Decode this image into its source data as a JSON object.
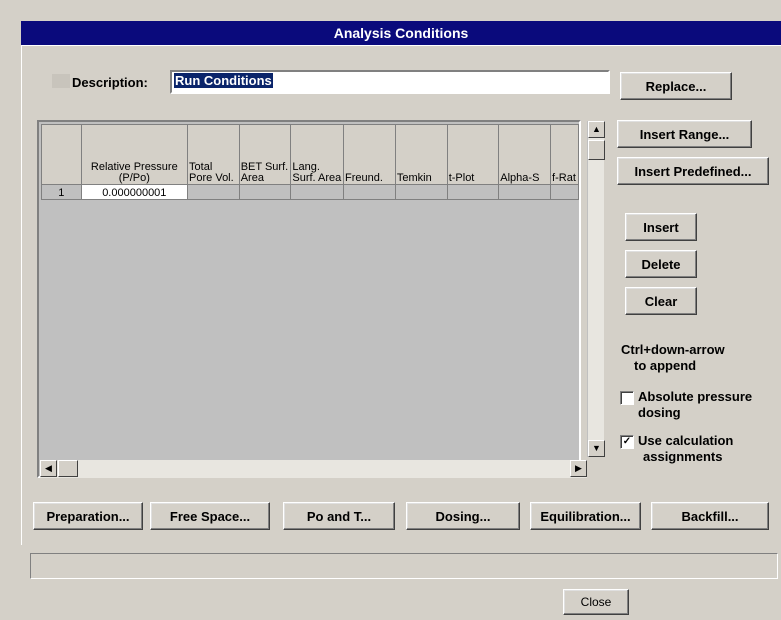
{
  "window": {
    "title": "Analysis Conditions"
  },
  "description": {
    "label": "Description:",
    "value": "Run Conditions"
  },
  "buttons": {
    "replace": "Replace...",
    "insert_range": "Insert Range...",
    "insert_predefined": "Insert Predefined...",
    "insert": "Insert",
    "delete": "Delete",
    "clear": "Clear",
    "close": "Close"
  },
  "note": {
    "line1": "Ctrl+down-arrow",
    "line2": "to append"
  },
  "checkboxes": {
    "absolute_pressure": {
      "label_line1": "Absolute pressure",
      "label_line2": "dosing",
      "checked": false
    },
    "calc_assignments": {
      "label_line1": "Use calculation",
      "label_line2": "assignments",
      "checked": true,
      "mark": "✓"
    }
  },
  "grid": {
    "columns": [
      "",
      "Relative Pressure (P/Po)",
      "Total Pore Vol.",
      "BET Surf. Area",
      "Lang. Surf. Area",
      "Freund.",
      "Temkin",
      "t-Plot",
      "Alpha-S",
      "f-Rat"
    ],
    "rows": [
      {
        "num": "1",
        "pressure": "0.000000001"
      }
    ]
  },
  "bottom_buttons": {
    "preparation": "Preparation...",
    "free_space": "Free Space...",
    "po_and_t": "Po and T...",
    "dosing": "Dosing...",
    "equilibration": "Equilibration...",
    "backfill": "Backfill..."
  }
}
